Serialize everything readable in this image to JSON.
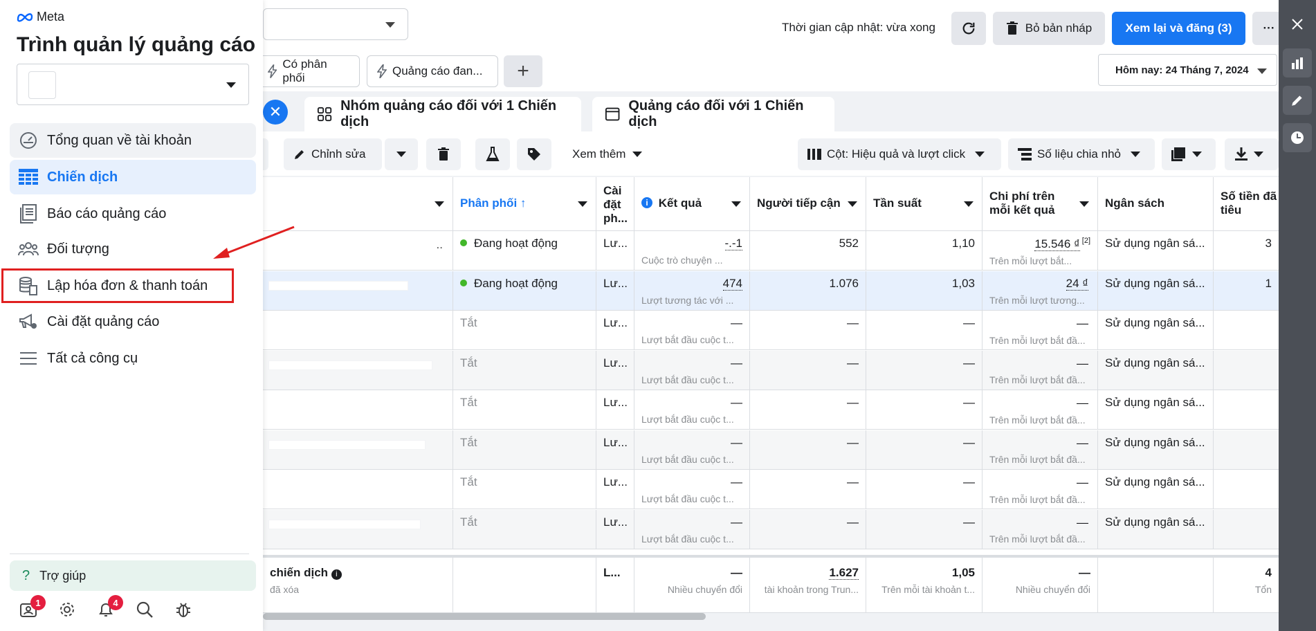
{
  "sidebar": {
    "brand": "Meta",
    "title": "Trình quản lý quảng cáo",
    "nav": [
      {
        "label": "Tổng quan về tài khoản",
        "icon": "dashboard-icon"
      },
      {
        "label": "Chiến dịch",
        "icon": "table-grid-icon"
      },
      {
        "label": "Báo cáo quảng cáo",
        "icon": "report-icon"
      },
      {
        "label": "Đối tượng",
        "icon": "audience-icon"
      },
      {
        "label": "Lập hóa đơn & thanh toán",
        "icon": "billing-icon"
      },
      {
        "label": "Cài đặt quảng cáo",
        "icon": "megaphone-settings-icon"
      },
      {
        "label": "Tất cả công cụ",
        "icon": "menu-icon"
      }
    ],
    "help": "Trợ giúp",
    "badges": {
      "account": "1",
      "notifications": "4"
    }
  },
  "topbar": {
    "update_text": "Thời gian cập nhật: vừa xong",
    "discard_label": "Bỏ bản nháp",
    "publish_label": "Xem lại và đăng (3)",
    "more_label": "···"
  },
  "filters": {
    "chip1": "Có phân phối",
    "chip2": "Quảng cáo đan...",
    "add": "+",
    "date": "Hôm nay: 24 Tháng 7, 2024"
  },
  "tabs": {
    "adsets": "Nhóm quảng cáo đối với 1 Chiến dịch",
    "ads": "Quảng cáo đối với 1 Chiến dịch"
  },
  "toolbar": {
    "edit": "Chỉnh sửa",
    "more": "Xem thêm",
    "columns": "Cột: Hiệu quả và lượt click",
    "breakdown": "Số liệu chia nhỏ"
  },
  "table": {
    "headers": {
      "delivery": "Phân phối ↑",
      "bid1": "Cài",
      "bid2": "đặt",
      "bid3": "ph...",
      "results": "Kết quả",
      "reach": "Người tiếp cận",
      "frequency": "Tần suất",
      "cpr1": "Chi phí trên",
      "cpr2": "mỗi kết quả",
      "budget": "Ngân sách",
      "spent1": "Số tiền đã",
      "spent2": "tiêu"
    },
    "rows": [
      {
        "name": "..",
        "delivery": "Đang hoạt động",
        "active": true,
        "bid": "Lư...",
        "result": "-.-1",
        "result_sub": "Cuộc trò chuyện ...",
        "reach": "552",
        "freq": "1,10",
        "cpr": "15.546 ₫",
        "cpr_note": "[2]",
        "cpr_sub": "Trên mỗi lượt bắt...",
        "budget": "Sử dụng ngân sá...",
        "spent": "3"
      },
      {
        "name": "",
        "delivery": "Đang hoạt động",
        "active": true,
        "bid": "Lư...",
        "result": "474",
        "result_sub": "Lượt tương tác với ...",
        "reach": "1.076",
        "freq": "1,03",
        "cpr": "24 ₫",
        "cpr_note": "",
        "cpr_sub": "Trên mỗi lượt tương...",
        "budget": "Sử dụng ngân sá...",
        "spent": "1"
      },
      {
        "name": "",
        "delivery": "Tắt",
        "active": false,
        "bid": "Lư...",
        "result": "—",
        "result_sub": "Lượt bắt đầu cuộc t...",
        "reach": "—",
        "freq": "—",
        "cpr": "—",
        "cpr_note": "",
        "cpr_sub": "Trên mỗi lượt bắt đầ...",
        "budget": "Sử dụng ngân sá...",
        "spent": ""
      },
      {
        "name": "",
        "delivery": "Tắt",
        "active": false,
        "bid": "Lư...",
        "result": "—",
        "result_sub": "Lượt bắt đầu cuộc t...",
        "reach": "—",
        "freq": "—",
        "cpr": "—",
        "cpr_note": "",
        "cpr_sub": "Trên mỗi lượt bắt đầ...",
        "budget": "Sử dụng ngân sá...",
        "spent": ""
      },
      {
        "name": "",
        "delivery": "Tắt",
        "active": false,
        "bid": "Lư...",
        "result": "—",
        "result_sub": "Lượt bắt đầu cuộc t...",
        "reach": "—",
        "freq": "—",
        "cpr": "—",
        "cpr_note": "",
        "cpr_sub": "Trên mỗi lượt bắt đầ...",
        "budget": "Sử dụng ngân sá...",
        "spent": ""
      },
      {
        "name": "",
        "delivery": "Tắt",
        "active": false,
        "bid": "Lư...",
        "result": "—",
        "result_sub": "Lượt bắt đầu cuộc t...",
        "reach": "—",
        "freq": "—",
        "cpr": "—",
        "cpr_note": "",
        "cpr_sub": "Trên mỗi lượt bắt đầ...",
        "budget": "Sử dụng ngân sá...",
        "spent": ""
      },
      {
        "name": "",
        "delivery": "Tắt",
        "active": false,
        "bid": "Lư...",
        "result": "—",
        "result_sub": "Lượt bắt đầu cuộc t...",
        "reach": "—",
        "freq": "—",
        "cpr": "—",
        "cpr_note": "",
        "cpr_sub": "Trên mỗi lượt bắt đầ...",
        "budget": "Sử dụng ngân sá...",
        "spent": ""
      },
      {
        "name": "",
        "delivery": "Tắt",
        "active": false,
        "bid": "Lư...",
        "result": "—",
        "result_sub": "Lượt bắt đầu cuộc t...",
        "reach": "—",
        "freq": "—",
        "cpr": "—",
        "cpr_note": "",
        "cpr_sub": "Trên mỗi lượt bắt đầ...",
        "budget": "Sử dụng ngân sá...",
        "spent": ""
      }
    ],
    "totals": {
      "name": "chiến dịch",
      "name_sub": "đã xóa",
      "bid": "L...",
      "result": "—",
      "result_sub": "Nhiều chuyển đổi",
      "reach": "1.627",
      "reach_sub": "tài khoản trong Trun...",
      "freq": "1,05",
      "freq_sub": "Trên mỗi tài khoản t...",
      "cpr": "—",
      "cpr_sub": "Nhiều chuyển đổi",
      "spent": "4",
      "spent_sub": "Tổn"
    }
  },
  "colors": {
    "accent": "#1877f2",
    "active_dot": "#42b72a",
    "highlight": "#e02020",
    "badge": "#e41e3f"
  }
}
